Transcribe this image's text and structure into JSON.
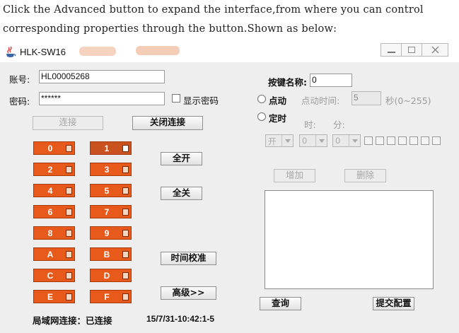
{
  "caption": {
    "line1": "Click the Advanced button to expand the interface,from where you can control",
    "line2": "corresponding properties through the button.Shown as below:"
  },
  "window": {
    "title": "HLK-SW16",
    "app_icon": "java-coffee-cup-icon"
  },
  "login": {
    "account_label": "账号:",
    "account_value": "HL00005268",
    "password_label": "密码:",
    "password_value": "******",
    "show_password_label": "显示密码",
    "connect_label": "连接",
    "disconnect_label": "关闭连接"
  },
  "relays": {
    "left": [
      "0",
      "2",
      "4",
      "6",
      "8",
      "A",
      "C",
      "E"
    ],
    "right": [
      "1",
      "3",
      "5",
      "7",
      "9",
      "B",
      "D",
      "F"
    ],
    "selected": "1",
    "check_glyph": "k"
  },
  "actions": {
    "all_on": "全开",
    "all_off": "全关",
    "time_sync": "时间校准",
    "advanced": "高级>>"
  },
  "status": {
    "lan_label": "局域网连接：已连接",
    "timestamp": "15/7/31-10:42:1-5"
  },
  "advanced": {
    "key_name_label": "按键名称:",
    "key_name_value": "0",
    "jog_label": "点动",
    "jog_time_label": "点动时间:",
    "jog_time_value": "5",
    "jog_range": "秒(0~255)",
    "timer_label": "定时",
    "hour_label": "时:",
    "minute_label": "分:",
    "switch_value": "开",
    "hour_value": "0",
    "minute_value": "0",
    "add_label": "增加",
    "delete_label": "删除",
    "query_label": "查询",
    "submit_label": "提交配置"
  }
}
